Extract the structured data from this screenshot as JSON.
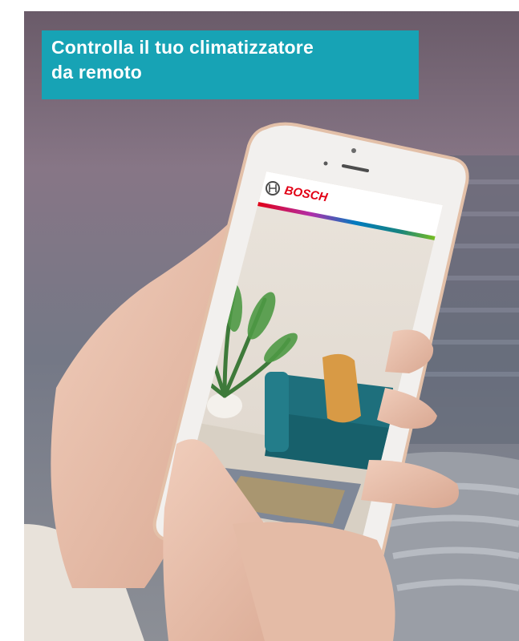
{
  "caption": {
    "line1": "Controlla il tuo climatizzatore",
    "line2": "da remoto"
  },
  "phone_screen": {
    "brand_logo_text": "BOSCH",
    "brand_icon": "bosch-armature-icon"
  },
  "colors": {
    "caption_background": "#17a3b5",
    "caption_text": "#ffffff",
    "brand_red": "#e20015",
    "phone_body": "#e8c9b5",
    "sofa": "#1e6f7c",
    "cushion": "#d89a45"
  }
}
